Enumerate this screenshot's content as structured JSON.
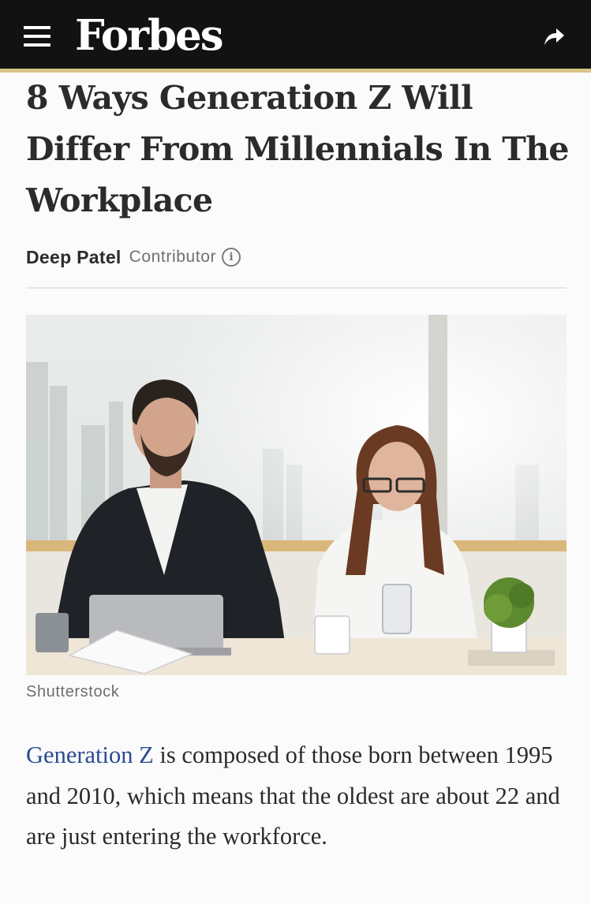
{
  "header": {
    "menu_icon": "hamburger-menu-icon",
    "brand": "Forbes",
    "share_icon": "share-arrow-icon",
    "accent_color": "#d8c487",
    "background_color": "#121212"
  },
  "article": {
    "headline": "8 Ways Generation Z Will Differ From Millennials In The Workplace",
    "author": "Deep Patel",
    "role": "Contributor",
    "info_icon": "info-icon",
    "image": {
      "credit": "Shutterstock"
    },
    "body": {
      "link_text": "Generation Z",
      "link_color": "#2a4b8f",
      "rest_text": " is composed of those born between 1995 and 2010, which means that the oldest are about 22 and are just entering the workforce."
    }
  }
}
